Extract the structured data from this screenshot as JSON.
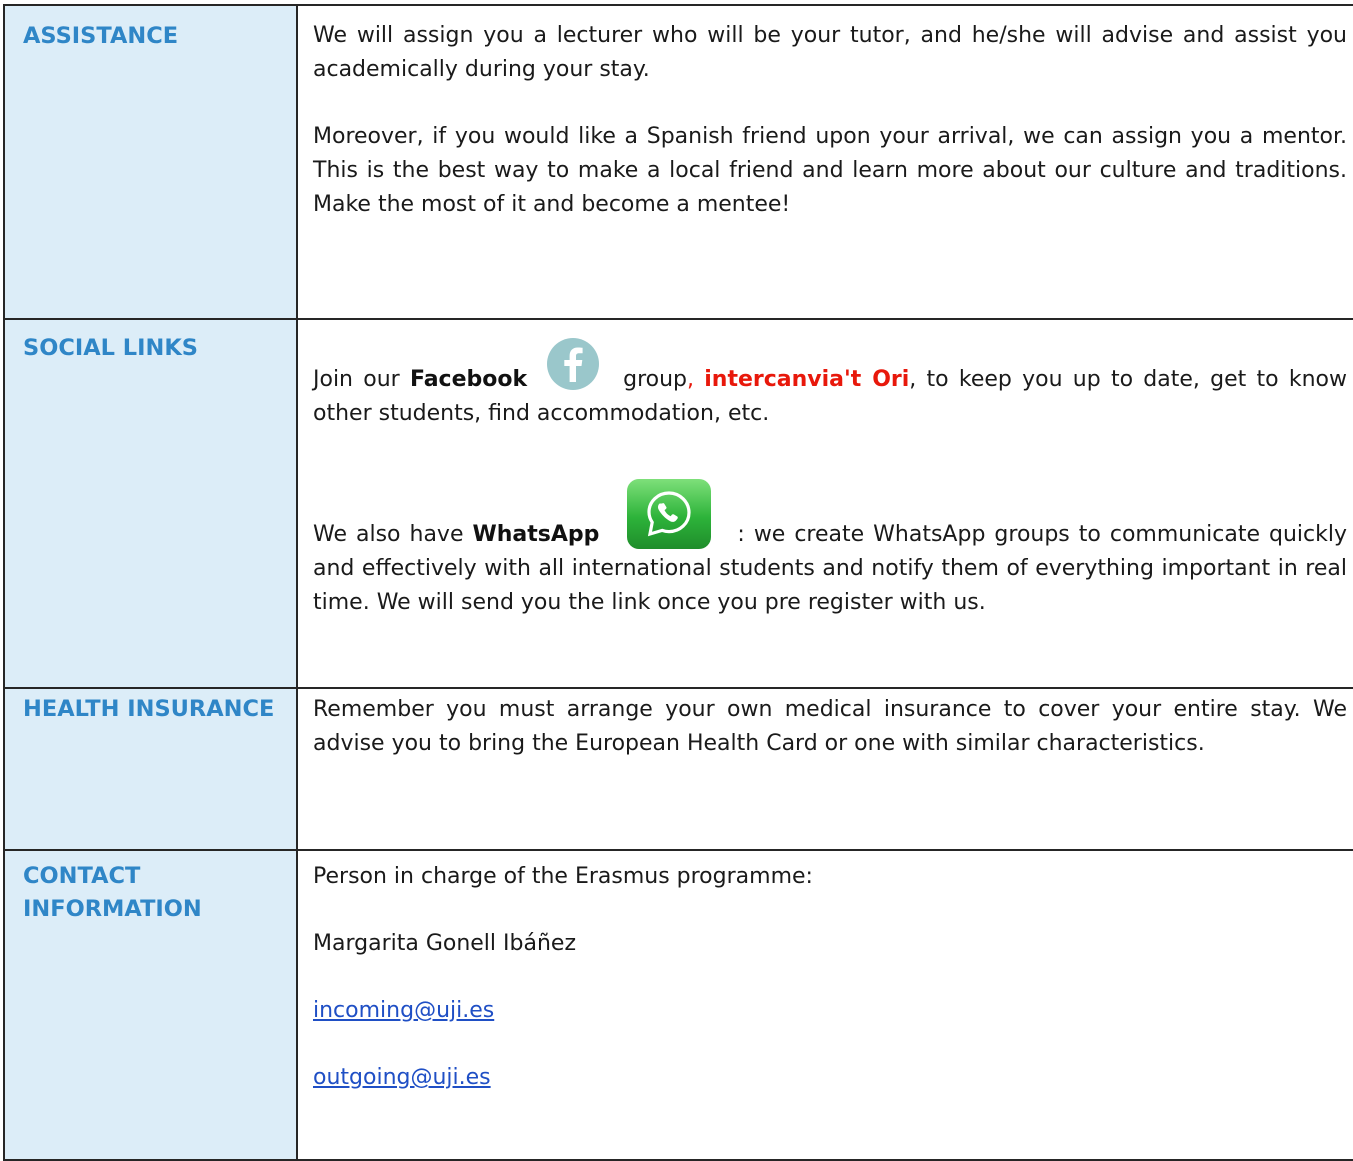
{
  "rows": [
    {
      "label": "ASSISTANCE",
      "para1": "We will assign you a lecturer who will be your tutor, and he/she will advise and assist you academically during your stay.",
      "para2": "Moreover, if you would like a Spanish friend upon your arrival, we can assign you a mentor. This is the best way to make a local friend and learn more about our culture and traditions. Make the most of it and become a mentee!"
    },
    {
      "label": "SOCIAL LINKS",
      "fb_prefix": "Join our ",
      "fb_bold": "Facebook",
      "fb_group_word": "group",
      "fb_comma": ", ",
      "fb_group_name": "intercanvia't Ori",
      "fb_suffix": ", to keep you up to date, get to know other students, find accommodation, etc.",
      "wa_prefix": "We also have ",
      "wa_bold": "WhatsApp",
      "wa_suffix": ": we create WhatsApp groups to communicate quickly and effectively with all international students and notify them of everything important in real time. We will send you the link once you pre register with us."
    },
    {
      "label": "HEALTH INSURANCE",
      "para1": "Remember you must arrange your own medical insurance to cover your entire stay. We advise you to bring the European Health Card or one with similar characteristics."
    },
    {
      "label": "CONTACT INFORMATION",
      "intro": "Person in charge of the Erasmus programme:",
      "person": "Margarita Gonell Ibáñez",
      "email_incoming": "incoming@uji.es",
      "email_outgoing": "outgoing@uji.es"
    }
  ],
  "icons": {
    "facebook": "facebook-icon",
    "whatsapp": "whatsapp-icon"
  },
  "colors": {
    "label_text": "#2f86c7",
    "label_bg": "#dcedf8",
    "highlight_red": "#e8180b",
    "link_blue": "#1f4fc5",
    "border": "#262626"
  }
}
